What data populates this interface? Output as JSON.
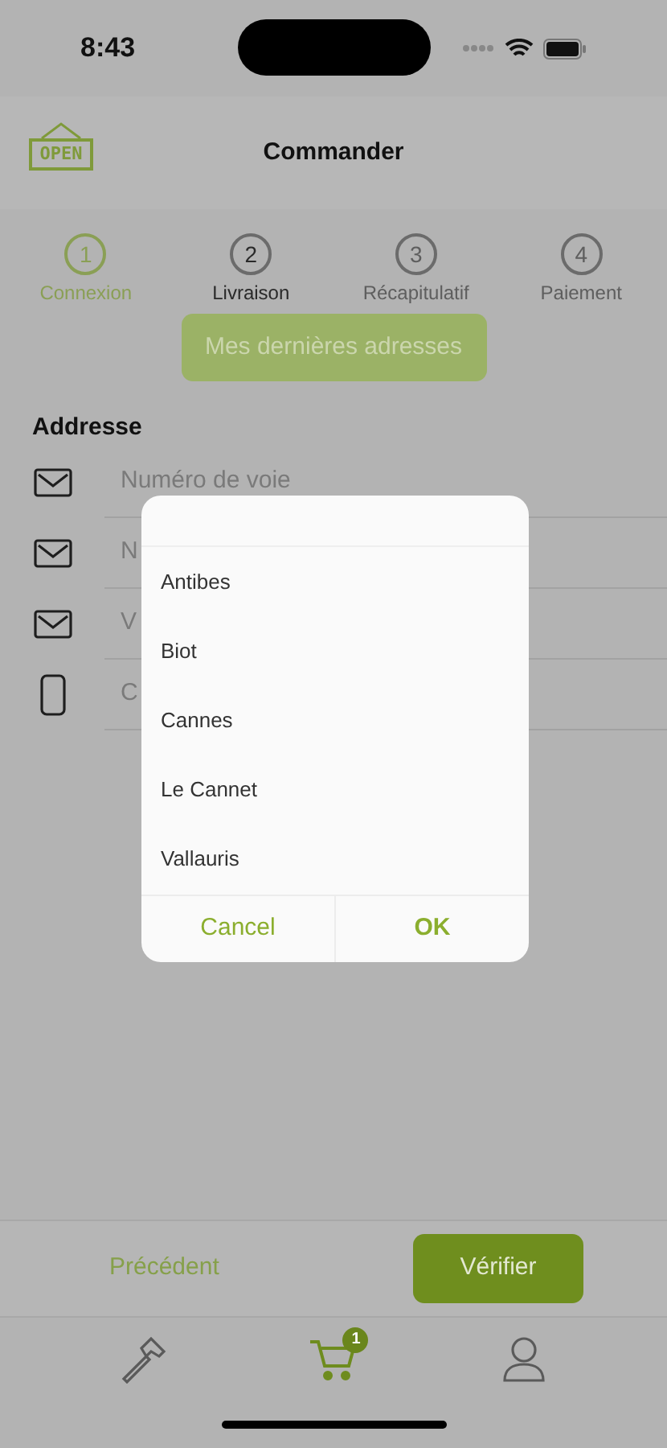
{
  "status_bar": {
    "time": "8:43"
  },
  "header": {
    "logo": "OPEN",
    "title": "Commander"
  },
  "steps": [
    {
      "number": "1",
      "label": "Connexion",
      "kind": "done"
    },
    {
      "number": "2",
      "label": "Livraison",
      "kind": "current"
    },
    {
      "number": "3",
      "label": "Récapitulatif",
      "kind": "pending"
    },
    {
      "number": "4",
      "label": "Paiement",
      "kind": "pending"
    }
  ],
  "recent_button": "Mes dernières adresses",
  "section_label": "Addresse",
  "fields": [
    {
      "kind": "mail",
      "placeholder": "Numéro de voie"
    },
    {
      "kind": "mail",
      "placeholder": "N"
    },
    {
      "kind": "mail",
      "placeholder": "V"
    },
    {
      "kind": "phone",
      "placeholder": "C"
    }
  ],
  "picker": {
    "options": [
      "Antibes",
      "Biot",
      "Cannes",
      "Le Cannet",
      "Vallauris"
    ],
    "cancel": "Cancel",
    "ok": "OK"
  },
  "footer": {
    "previous": "Précédent",
    "next": "Vérifier"
  },
  "tab_bar": [
    {
      "kind": "hammer",
      "selected": false
    },
    {
      "kind": "cart",
      "selected": true,
      "badge": "1"
    },
    {
      "kind": "person",
      "selected": false
    }
  ]
}
